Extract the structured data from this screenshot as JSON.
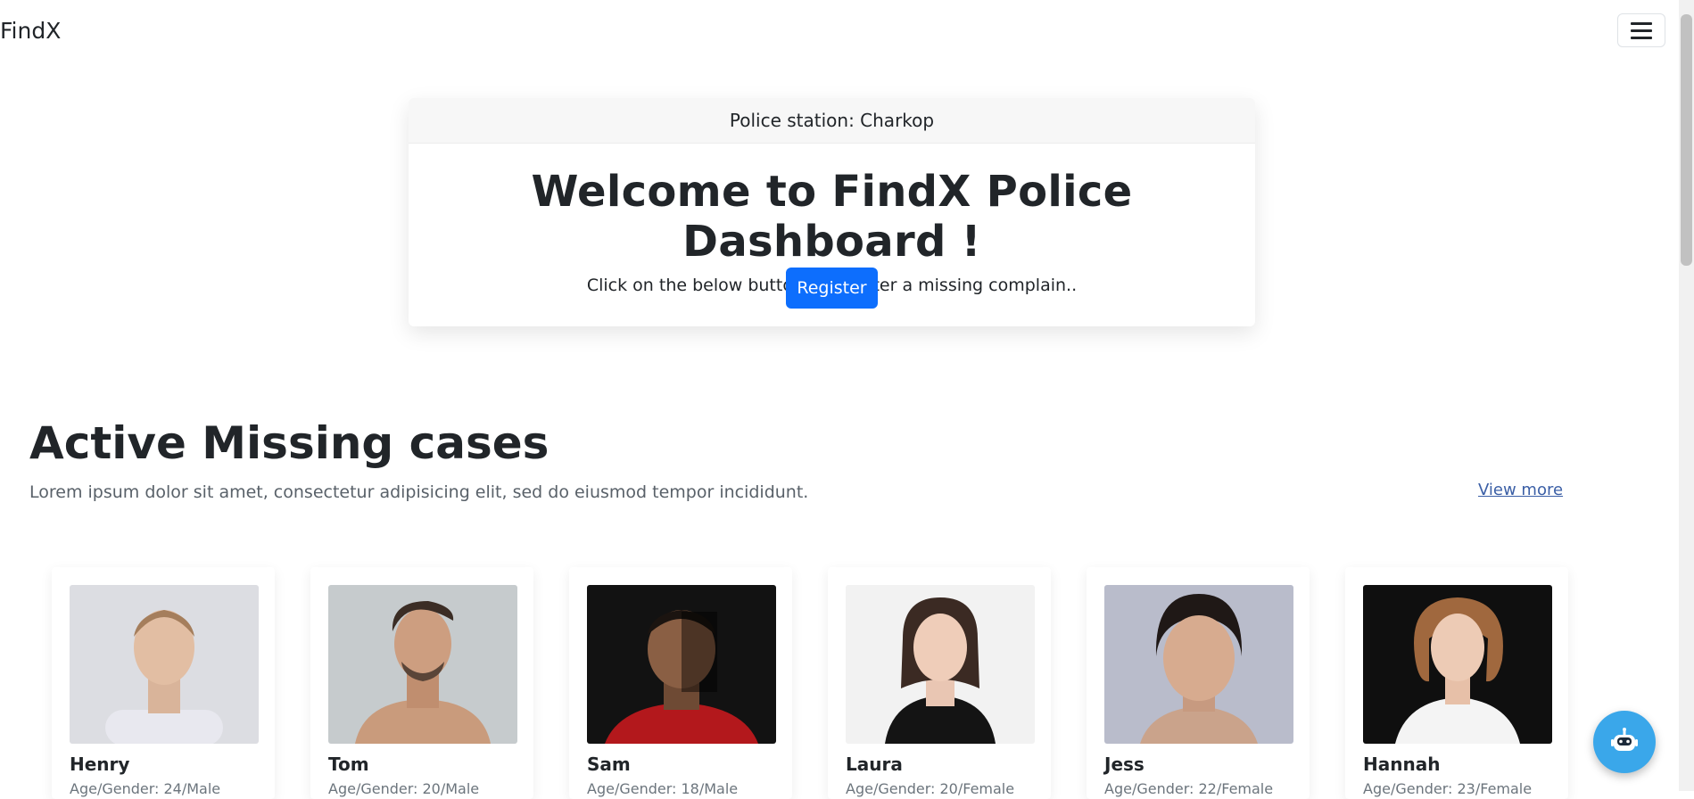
{
  "navbar": {
    "brand": "FindX",
    "menu_icon": "hamburger-icon"
  },
  "welcome": {
    "header": "Police station: Charkop",
    "title": "Welcome to FindX Police Dashboard !",
    "subtitle": "Click on the below button to register a missing complain..",
    "register_label": "Register",
    "accent": "#0d6efd"
  },
  "section": {
    "title": "Active Missing cases",
    "description": "Lorem ipsum dolor sit amet, consectetur adipisicing elit, sed do eiusmod tempor incididunt.",
    "view_more": "View more"
  },
  "cases": [
    {
      "name": "Henry",
      "info": "Age/Gender: 24/Male"
    },
    {
      "name": "Tom",
      "info": "Age/Gender: 20/Male"
    },
    {
      "name": "Sam",
      "info": "Age/Gender: 18/Male"
    },
    {
      "name": "Laura",
      "info": "Age/Gender: 20/Female"
    },
    {
      "name": "Jess",
      "info": "Age/Gender: 22/Female"
    },
    {
      "name": "Hannah",
      "info": "Age/Gender: 23/Female"
    }
  ],
  "chatbot": {
    "icon": "robot-icon"
  }
}
